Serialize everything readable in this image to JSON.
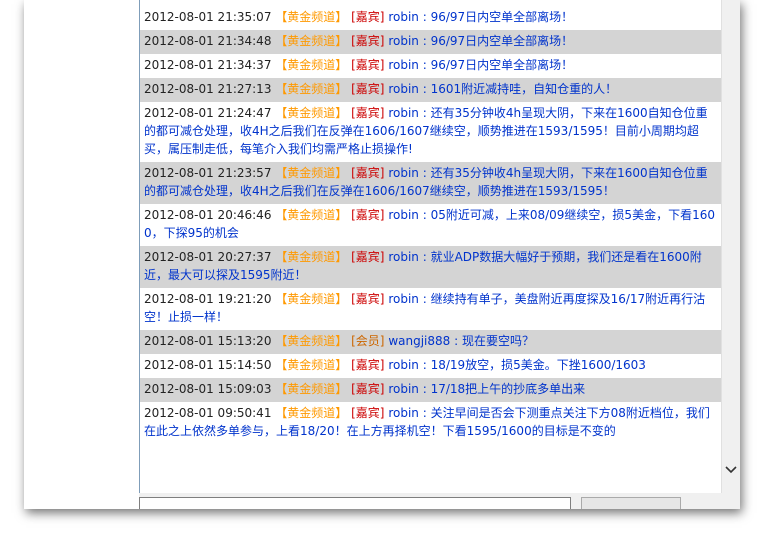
{
  "messages": [
    {
      "time": "2012-08-01 21:35:07",
      "channel": "【黄金频道】",
      "role": "[嘉宾]",
      "user": "robin",
      "sep": " : ",
      "text": "96/97日内空单全部离场！"
    },
    {
      "time": "2012-08-01 21:34:48",
      "channel": "【黄金频道】",
      "role": "[嘉宾]",
      "user": "robin",
      "sep": " : ",
      "text": "96/97日内空单全部离场！"
    },
    {
      "time": "2012-08-01 21:34:37",
      "channel": "【黄金频道】",
      "role": "[嘉宾]",
      "user": "robin",
      "sep": " : ",
      "text": "96/97日内空单全部离场！"
    },
    {
      "time": "2012-08-01 21:27:13",
      "channel": "【黄金频道】",
      "role": "[嘉宾]",
      "user": "robin",
      "sep": " : ",
      "text": "1601附近减持哇，自知仓重的人！"
    },
    {
      "time": "2012-08-01 21:24:47",
      "channel": "【黄金频道】",
      "role": "[嘉宾]",
      "user": "robin",
      "sep": " : ",
      "text": "还有35分钟收4h呈现大阴，下来在1600自知仓位重的都可减仓处理，收4H之后我们在反弹在1606/1607继续空，顺势推进在1593/1595！目前小周期均超买，属压制走低，每笔介入我们均需严格止损操作!"
    },
    {
      "time": "2012-08-01 21:23:57",
      "channel": "【黄金频道】",
      "role": "[嘉宾]",
      "user": "robin",
      "sep": " : ",
      "text": "还有35分钟收4h呈现大阴，下来在1600自知仓位重的都可减仓处理，收4H之后我们在反弹在1606/1607继续空，顺势推进在1593/1595！"
    },
    {
      "time": "2012-08-01 20:46:46",
      "channel": "【黄金频道】",
      "role": "[嘉宾]",
      "user": "robin",
      "sep": " : ",
      "text": "05附近可减，上来08/09继续空，损5美金，下看1600，下探95的机会"
    },
    {
      "time": "2012-08-01 20:27:37",
      "channel": "【黄金频道】",
      "role": "[嘉宾]",
      "user": "robin",
      "sep": " : ",
      "text": "就业ADP数据大幅好于预期，我们还是看在1600附近，最大可以探及1595附近！"
    },
    {
      "time": "2012-08-01 19:21:20",
      "channel": "【黄金频道】",
      "role": "[嘉宾]",
      "user": "robin",
      "sep": " : ",
      "text": "继续持有单子，美盘附近再度探及16/17附近再行沽空！止损一样！"
    },
    {
      "time": "2012-08-01 15:13:20",
      "channel": "【黄金频道】",
      "role": "[会员]",
      "user": "wangji888",
      "sep": " : ",
      "text": "现在要空吗？"
    },
    {
      "time": "2012-08-01 15:14:50",
      "channel": "【黄金频道】",
      "role": "[嘉宾]",
      "user": "robin",
      "sep": " : ",
      "text": "18/19放空，损5美金。下挫1600/1603"
    },
    {
      "time": "2012-08-01 15:09:03",
      "channel": "【黄金频道】",
      "role": "[嘉宾]",
      "user": "robin",
      "sep": " : ",
      "text": "17/18把上午的抄底多单出来"
    },
    {
      "time": "2012-08-01 09:50:41",
      "channel": "【黄金频道】",
      "role": "[嘉宾]",
      "user": "robin",
      "sep": " : ",
      "text": "关注早间是否会下测重点关注下方08附近档位，我们在此之上依然多单参与，上看18/20！在上方再择机空！下看1595/1600的目标是不变的"
    }
  ],
  "colors": {
    "alt_row": "#d4d4d4",
    "channel": "#ff9900",
    "guest": "#cc0000",
    "text": "#0033cc"
  },
  "scrollbar": {
    "arrow_icon": "chevron-down-icon"
  }
}
